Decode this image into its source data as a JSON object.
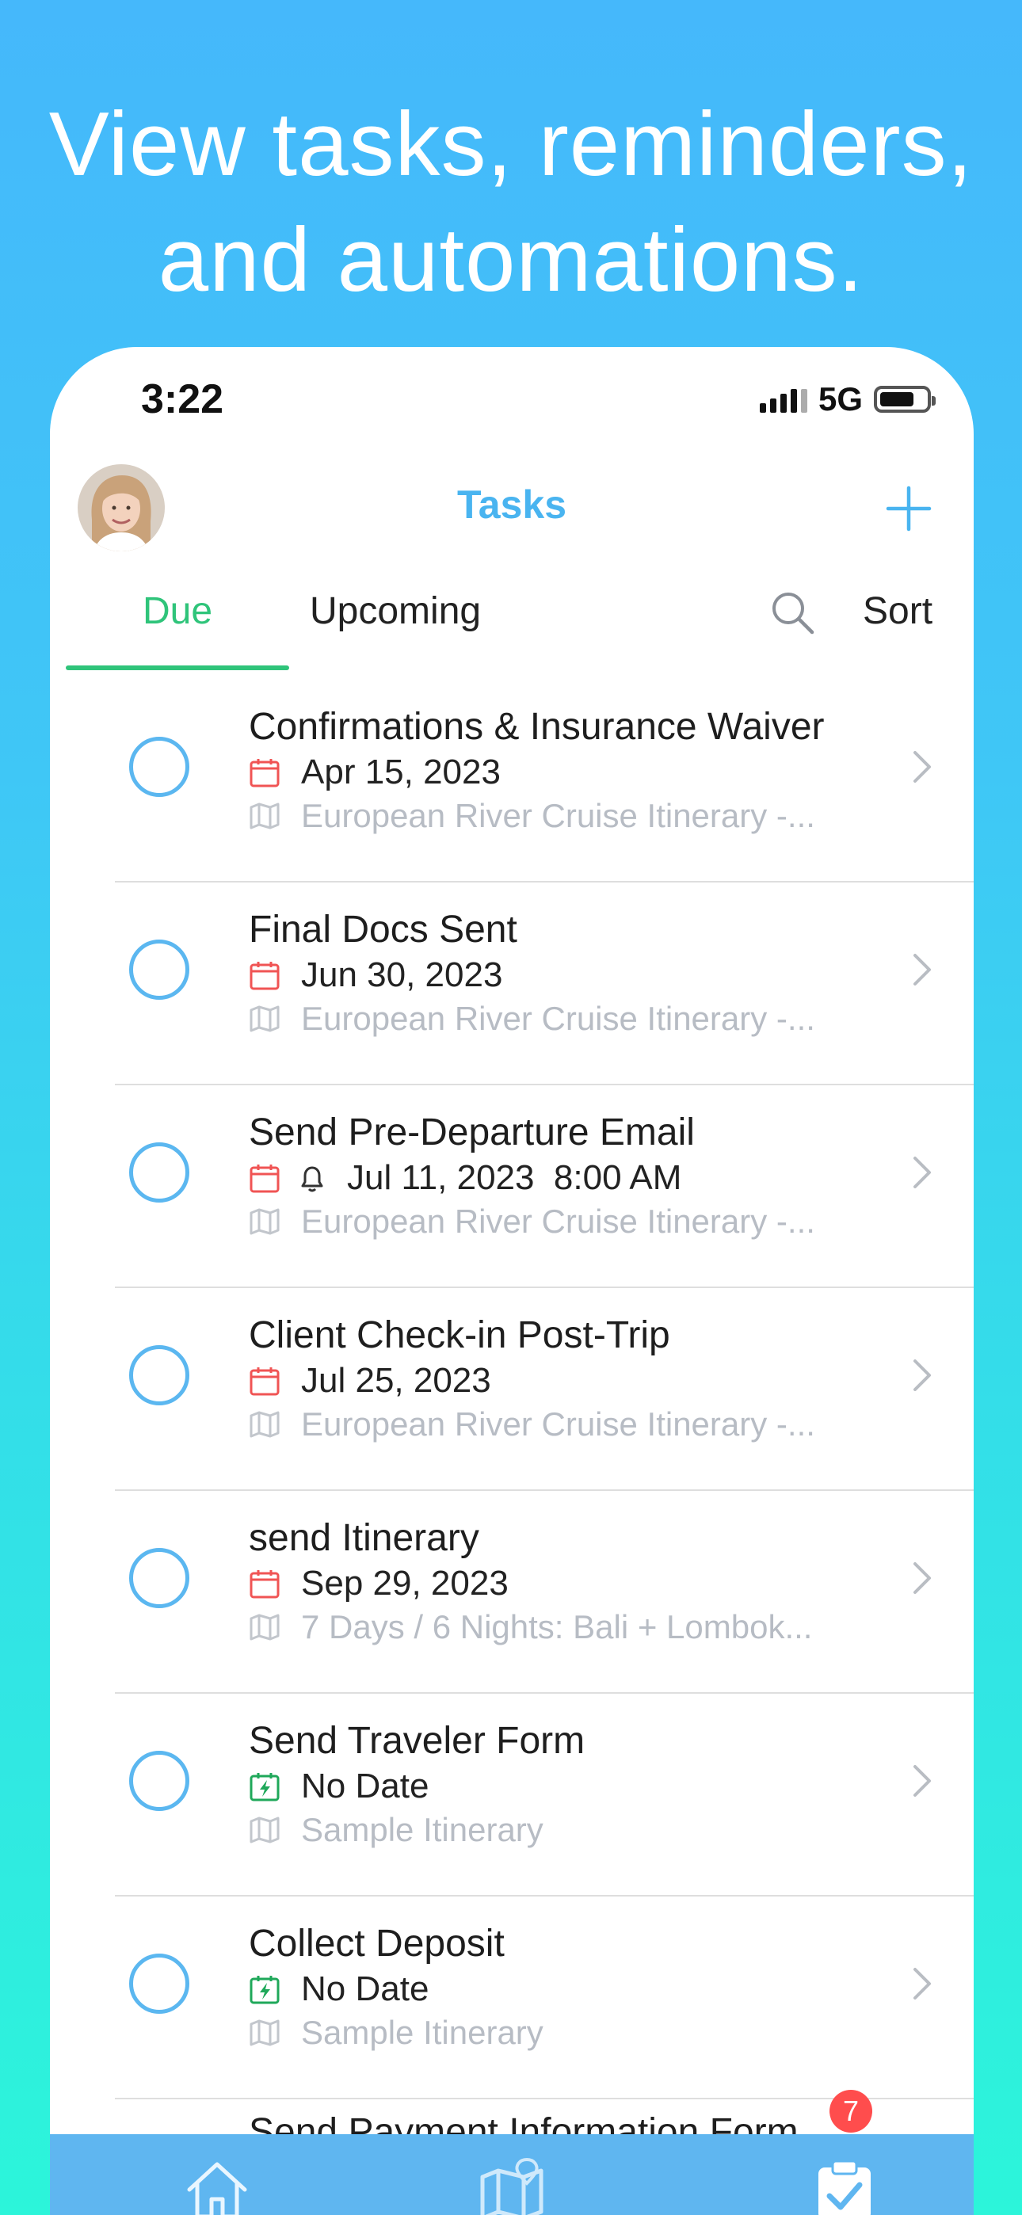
{
  "headline": {
    "line1": "View tasks, reminders,",
    "line2": "and automations."
  },
  "status_bar": {
    "time": "3:22",
    "network": "5G"
  },
  "nav": {
    "title": "Tasks"
  },
  "tabs": {
    "due": "Due",
    "upcoming": "Upcoming",
    "sort": "Sort"
  },
  "tasks": [
    {
      "title": "Confirmations & Insurance Waiver",
      "date": "Apr 15, 2023",
      "icon": "calendar-icon",
      "subtitle": "European River Cruise Itinerary -..."
    },
    {
      "title": "Final Docs Sent",
      "date": "Jun 30, 2023",
      "icon": "calendar-icon",
      "subtitle": "European River Cruise Itinerary -..."
    },
    {
      "title": "Send Pre-Departure Email",
      "date": "Jul 11, 2023  8:00 AM",
      "icon": "calendar-icon",
      "reminder": "bell-icon",
      "subtitle": "European River Cruise Itinerary -..."
    },
    {
      "title": "Client Check-in Post-Trip",
      "date": "Jul 25, 2023",
      "icon": "calendar-icon",
      "subtitle": "European River Cruise Itinerary -..."
    },
    {
      "title": "send Itinerary",
      "date": "Sep 29, 2023",
      "icon": "calendar-icon",
      "subtitle": "7 Days / 6 Nights: Bali + Lombok..."
    },
    {
      "title": "Send Traveler Form",
      "date": "No Date",
      "icon": "automation-icon",
      "subtitle": "Sample Itinerary"
    },
    {
      "title": "Collect Deposit",
      "date": "No Date",
      "icon": "automation-icon",
      "subtitle": "Sample Itinerary"
    }
  ],
  "peek_title": "Send Payment Information Form",
  "tabbar": {
    "badge": "7"
  },
  "colors": {
    "accent_blue": "#49b4f0",
    "accent_green": "#2fc47a",
    "calendar_red": "#f05454",
    "tabbar_blue": "#5fb6f0"
  }
}
